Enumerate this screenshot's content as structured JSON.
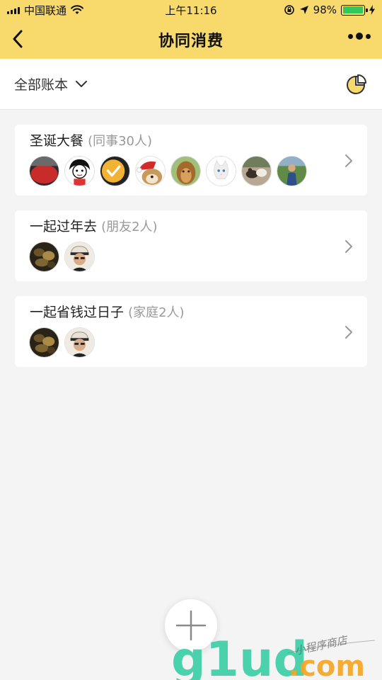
{
  "status_bar": {
    "carrier": "中国联通",
    "time": "上午11:16",
    "battery_percent": "98%",
    "battery_level": 0.98
  },
  "nav": {
    "title": "协同消费"
  },
  "filter": {
    "label": "全部账本"
  },
  "cards": [
    {
      "title": "圣诞大餐",
      "subtitle": "(同事30人)",
      "members_visible": 8
    },
    {
      "title": "一起过年去",
      "subtitle": "(朋友2人)",
      "members_visible": 2
    },
    {
      "title": "一起省钱过日子",
      "subtitle": "(家庭2人)",
      "members_visible": 2
    }
  ],
  "watermark": {
    "brand": "g1ud",
    "domain": ".com",
    "tagline": "小程序商店"
  },
  "icons": {
    "back": "chevron-left-icon",
    "more": "more-dots-icon",
    "dropdown": "chevron-down-icon",
    "chart": "pie-chart-icon",
    "add": "plus-icon"
  },
  "colors": {
    "brand_yellow": "#f7d96c",
    "background": "#f4f4f4",
    "card": "#ffffff",
    "muted_text": "#999999",
    "battery_green": "#34c85a",
    "watermark_teal": "#3ecfa8",
    "watermark_orange": "#f5a623"
  }
}
